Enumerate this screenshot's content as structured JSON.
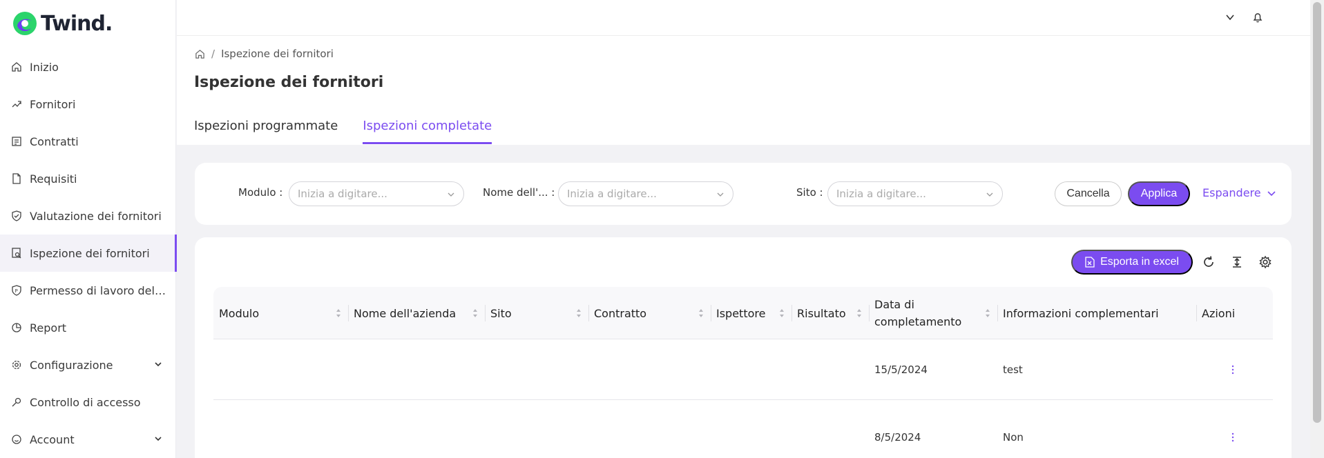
{
  "brand": {
    "name": "Twind.",
    "accent": "#7b4cf0",
    "logo_colors": [
      "#2bd46b",
      "#6c3ff0"
    ]
  },
  "sidebar": {
    "items": [
      {
        "label": "Inizio",
        "icon": "home-icon"
      },
      {
        "label": "Fornitori",
        "icon": "handshake-icon"
      },
      {
        "label": "Contratti",
        "icon": "contract-icon"
      },
      {
        "label": "Requisiti",
        "icon": "document-icon"
      },
      {
        "label": "Valutazione dei fornitori",
        "icon": "shield-check-icon"
      },
      {
        "label": "Ispezione dei fornitori",
        "icon": "inspection-icon",
        "active": true
      },
      {
        "label": "Permesso di lavoro del f...",
        "icon": "permit-icon"
      },
      {
        "label": "Report",
        "icon": "pie-chart-icon"
      },
      {
        "label": "Configurazione",
        "icon": "gear-icon",
        "expandable": true
      },
      {
        "label": "Controllo di accesso",
        "icon": "key-icon"
      },
      {
        "label": "Account",
        "icon": "smiley-icon",
        "expandable": true
      }
    ]
  },
  "breadcrumb": {
    "current": "Ispezione dei fornitori"
  },
  "page": {
    "title": "Ispezione dei fornitori"
  },
  "tabs": [
    {
      "label": "Ispezioni programmate",
      "active": false
    },
    {
      "label": "Ispezioni completate",
      "active": true
    }
  ],
  "filters": {
    "modulo": {
      "label": "Modulo",
      "placeholder": "Inizia a digitare..."
    },
    "nome": {
      "label": "Nome dell'...",
      "placeholder": "Inizia a digitare..."
    },
    "sito": {
      "label": "Sito",
      "placeholder": "Inizia a digitare..."
    },
    "cancel_label": "Cancella",
    "apply_label": "Applica",
    "expand_label": "Espandere"
  },
  "table": {
    "export_label": "Esporta in excel",
    "columns": [
      "Modulo",
      "Nome dell'azienda",
      "Sito",
      "Contratto",
      "Ispettore",
      "Risultato",
      "Data di completamento",
      "Informazioni complementari",
      "Azioni"
    ],
    "rows": [
      {
        "modulo": "",
        "azienda": "",
        "sito": "",
        "contratto": "",
        "ispettore": "",
        "risultato": "",
        "data": "15/5/2024",
        "info": "test"
      },
      {
        "modulo": "",
        "azienda": "",
        "sito": "",
        "contratto": "",
        "ispettore": "",
        "risultato": "",
        "data": "8/5/2024",
        "info": "Non"
      }
    ]
  }
}
